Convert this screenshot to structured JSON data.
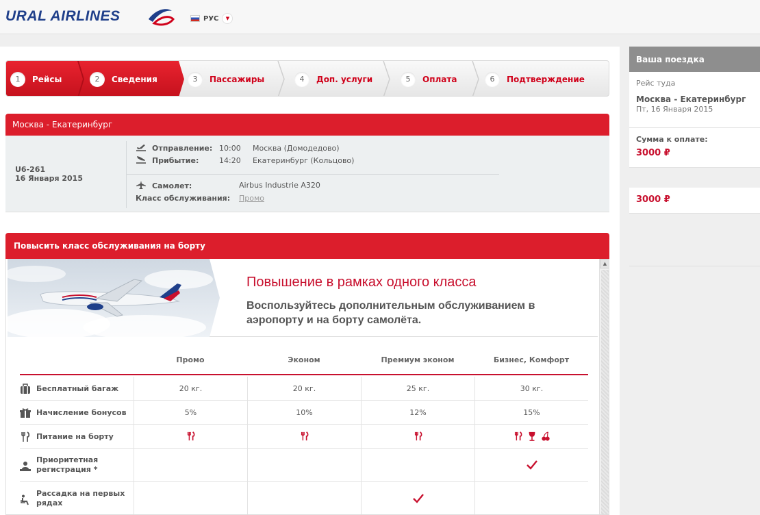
{
  "header": {
    "logo_text": "URAL AIRLINES",
    "language": "РУС",
    "language_flag": "ru-flag-icon"
  },
  "steps": [
    {
      "num": "1",
      "label": "Рейсы",
      "state": "done"
    },
    {
      "num": "2",
      "label": "Сведения",
      "state": "active"
    },
    {
      "num": "3",
      "label": "Пассажиры",
      "state": "pending"
    },
    {
      "num": "4",
      "label": "Доп. услуги",
      "state": "pending"
    },
    {
      "num": "5",
      "label": "Оплата",
      "state": "pending"
    },
    {
      "num": "6",
      "label": "Подтверждение",
      "state": "pending"
    }
  ],
  "flight": {
    "route_title": "Москва - Екатеринбург",
    "flight_number": "U6-261",
    "date": "16 Января 2015",
    "departure_label": "Отправление:",
    "departure_time": "10:00",
    "departure_airport": "Москва (Домодедово)",
    "arrival_label": "Прибытие:",
    "arrival_time": "14:20",
    "arrival_airport": "Екатеринбург (Кольцово)",
    "aircraft_label": "Самолет:",
    "aircraft": "Airbus Industrie A320",
    "class_label": "Класс обслуживания:",
    "class_value": "Промо"
  },
  "upgrade": {
    "section_title": "Повысить класс обслуживания на борту",
    "banner_title": "Повышение в рамках одного класса",
    "banner_subtitle": "Воспользуйтесь дополнительным обслуживанием в аэропорту и на борту самолёта.",
    "columns": [
      "Промо",
      "Эконом",
      "Премиум эконом",
      "Бизнес, Комфорт"
    ],
    "rows": [
      {
        "label": "Бесплатный багаж",
        "icon": "baggage-icon",
        "values": [
          "20 кг.",
          "20 кг.",
          "25 кг.",
          "30 кг."
        ]
      },
      {
        "label": "Начисление бонусов",
        "icon": "gift-icon",
        "values": [
          "5%",
          "10%",
          "12%",
          "15%"
        ]
      },
      {
        "label": "Питание на борту",
        "icon": "meal-icon",
        "values": [
          "meal",
          "meal",
          "meal",
          "meal-wine-dessert"
        ]
      },
      {
        "label": "Приоритетная регистрация *",
        "icon": "checkin-icon",
        "values": [
          "",
          "",
          "",
          "check"
        ]
      },
      {
        "label": "Рассадка на первых рядах",
        "icon": "seat-icon",
        "values": [
          "",
          "",
          "check",
          ""
        ]
      }
    ]
  },
  "sidebar": {
    "title": "Ваша поездка",
    "leg_label": "Рейс туда",
    "route": "Москва - Екатеринбург",
    "date": "Пт, 16 Января 2015",
    "total_label": "Сумма к оплате:",
    "total_price": "3000 ₽",
    "grand_total": "3000 ₽"
  },
  "colors": {
    "brand_red": "#dc1e2c",
    "brand_blue": "#1f3f8a",
    "sidebar_gray": "#8e8e8e"
  }
}
